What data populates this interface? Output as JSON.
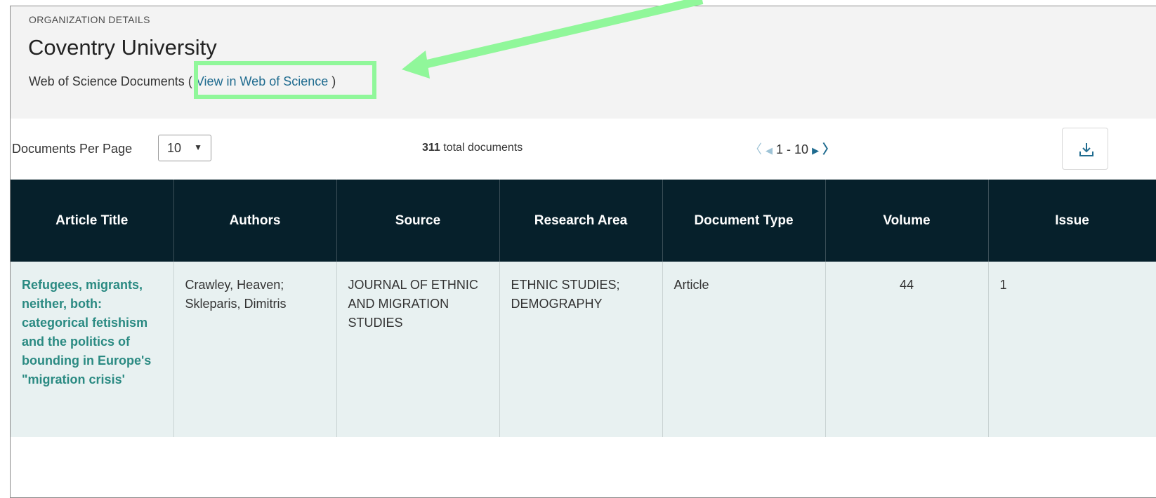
{
  "org": {
    "eyebrow": "ORGANIZATION DETAILS",
    "name": "Coventry University",
    "wos_label": "Web of Science Documents",
    "open_paren": "(",
    "link_text": "View in Web of Science",
    "close_paren": ")"
  },
  "controls": {
    "per_page_label": "Documents Per Page",
    "per_page_value": "10",
    "total_count": "311",
    "total_suffix": "total documents",
    "range": "1 - 10"
  },
  "table": {
    "headers": [
      "Article Title",
      "Authors",
      "Source",
      "Research Area",
      "Document Type",
      "Volume",
      "Issue"
    ],
    "rows": [
      {
        "title": "Refugees, migrants, neither, both: categorical fetishism and the politics of bounding in Europe's \"migration crisis'",
        "authors": "Crawley, Heaven; Skleparis, Dimitris",
        "source": "JOURNAL OF ETHNIC AND MIGRATION STUDIES",
        "research_area": "ETHNIC STUDIES; DEMOGRAPHY",
        "document_type": "Article",
        "volume": "44",
        "issue": "1"
      }
    ]
  },
  "colors": {
    "highlight": "#90f79a",
    "header_bg": "#06202b",
    "link": "#1f6b8f",
    "title_link": "#2a8a82",
    "row_bg": "#e8f1f1"
  },
  "icons": [
    "chevron-left-icon",
    "triangle-left-icon",
    "triangle-right-icon",
    "chevron-right-icon",
    "download-icon",
    "caret-down-icon",
    "arrow-annotation"
  ]
}
